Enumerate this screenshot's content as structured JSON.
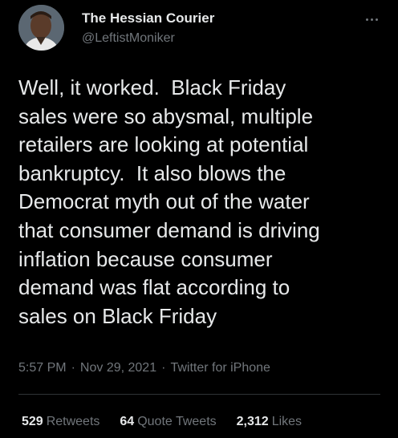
{
  "tweet": {
    "author_name": "The Hessian Courier",
    "handle": "@LeftistMoniker",
    "text": "Well, it worked.  Black Friday\nsales were so abysmal, multiple\nretailers are looking at potential\nbankruptcy.  It also blows the\nDemocrat myth out of the water\nthat consumer demand is driving\ninflation because consumer\ndemand was flat according to\nsales on Black Friday",
    "time": "5:57 PM",
    "date": "Nov 29, 2021",
    "source": "Twitter for iPhone",
    "separator": "·"
  },
  "stats": {
    "retweets_count": "529",
    "retweets_label": "Retweets",
    "quotes_count": "64",
    "quotes_label": "Quote Tweets",
    "likes_count": "2,312",
    "likes_label": "Likes"
  },
  "icons": {
    "more": "more-horizontal-icon",
    "avatar": "profile-photo"
  },
  "colors": {
    "background": "#000000",
    "primary_text": "#e7e9ea",
    "secondary_text": "#71767b",
    "divider": "#2f3336"
  }
}
